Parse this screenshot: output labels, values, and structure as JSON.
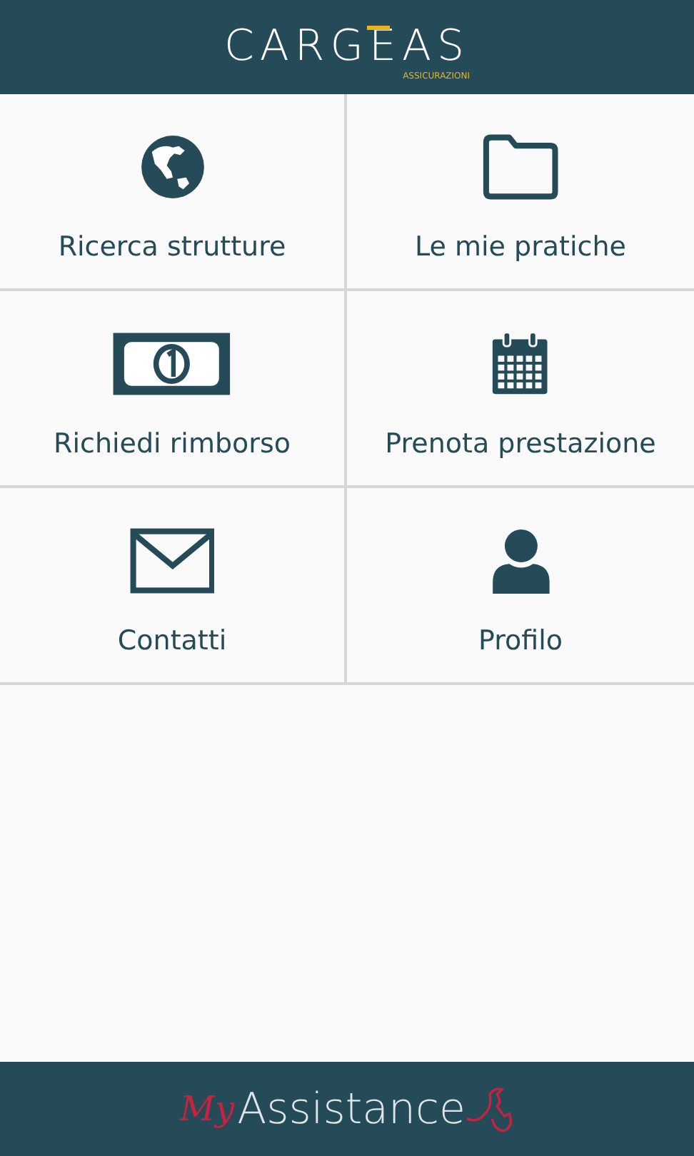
{
  "header": {
    "logo": "CARGEAS",
    "logo_sub": "ASSICURAZIONI"
  },
  "menu": [
    {
      "label": "Ricerca strutture",
      "kind": "globe"
    },
    {
      "label": "Le mie pratiche",
      "kind": "folder"
    },
    {
      "label": "Richiedi rimborso",
      "kind": "money"
    },
    {
      "label": "Prenota prestazione",
      "kind": "calendar"
    },
    {
      "label": "Contatti",
      "kind": "mail"
    },
    {
      "label": "Profilo",
      "kind": "person"
    }
  ],
  "footer": {
    "logo_prefix": "My",
    "logo": "Assistance"
  }
}
